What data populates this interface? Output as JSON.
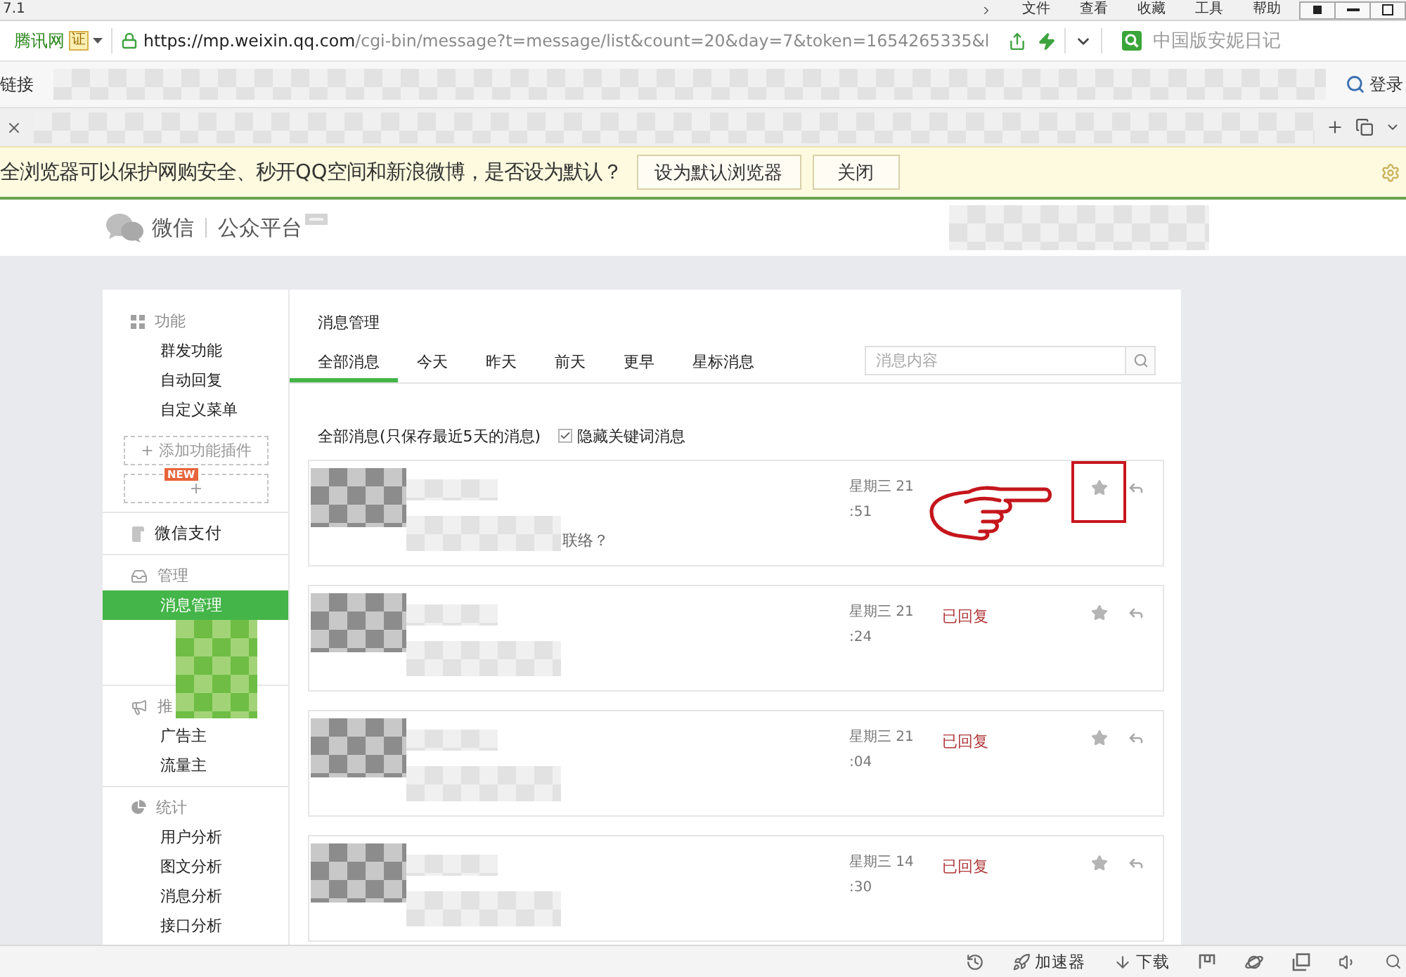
{
  "browser": {
    "title": "7.1",
    "menu": [
      "文件",
      "查看",
      "收藏",
      "工具",
      "帮助"
    ],
    "site_name": "腾讯网",
    "cert_badge": "证",
    "url": {
      "host": "https://mp.weixin.qq.com",
      "path": "/cgi-bin/message?t=message/list&count=20&day=7&token=1654265335&l"
    },
    "search": {
      "placeholder": "中国版安妮日记"
    },
    "bookmarks_label": "链接",
    "login": "登录"
  },
  "notification": {
    "message": "全浏览器可以保护网购安全、秒开QQ空间和新浪微博，是否设为默认？",
    "buttons": [
      "设为默认浏览器",
      "关闭"
    ]
  },
  "header": {
    "logo_text": "微信",
    "platform": "公众平台"
  },
  "sidebar": {
    "sections": [
      {
        "kind": "group",
        "title": "功能",
        "obscured": false,
        "items": [
          {
            "label": "群发功能",
            "selected": false
          },
          {
            "label": "自动回复",
            "selected": false
          },
          {
            "label": "自定义菜单",
            "selected": false
          }
        ],
        "plugins": [
          {
            "label": "+ 添加功能插件"
          },
          {
            "label": "+",
            "badge": "NEW"
          }
        ]
      },
      {
        "kind": "link",
        "title": "微信支付",
        "obscured": false
      },
      {
        "kind": "group",
        "title": "管理",
        "obscured": true,
        "items": [
          {
            "label": "消息管理",
            "selected": true
          }
        ]
      },
      {
        "kind": "group",
        "title": "推",
        "obscured": false,
        "items": [
          {
            "label": "广告主",
            "selected": false
          },
          {
            "label": "流量主",
            "selected": false
          }
        ]
      },
      {
        "kind": "group",
        "title": "统计",
        "obscured": false,
        "items": [
          {
            "label": "用户分析",
            "selected": false
          },
          {
            "label": "图文分析",
            "selected": false
          },
          {
            "label": "消息分析",
            "selected": false
          },
          {
            "label": "接口分析",
            "selected": false
          }
        ]
      }
    ]
  },
  "content": {
    "title": "消息管理",
    "tabs": [
      {
        "label": "全部消息",
        "selected": true
      },
      {
        "label": "今天",
        "selected": false
      },
      {
        "label": "昨天",
        "selected": false
      },
      {
        "label": "前天",
        "selected": false
      },
      {
        "label": "更早",
        "selected": false
      },
      {
        "label": "星标消息",
        "selected": false
      }
    ],
    "search": {
      "placeholder": "消息内容"
    },
    "filter": {
      "label": "全部消息(只保存最近5天的消息)",
      "hide_keywords": {
        "label": "隐藏关键词消息",
        "checked": true
      }
    },
    "messages": [
      {
        "preview": "联络？",
        "day": "星期三 21",
        "time": ":51",
        "starred": false,
        "highlighted": true
      },
      {
        "day": "星期三 21",
        "time": ":24",
        "status": "已回复",
        "starred": false,
        "highlighted": false
      },
      {
        "day": "星期三 21",
        "time": ":04",
        "status": "已回复",
        "starred": false,
        "highlighted": false
      },
      {
        "day": "星期三 14",
        "time": ":30",
        "status": "已回复",
        "starred": false,
        "highlighted": false
      }
    ]
  },
  "status_bar": {
    "accelerator": "加速器",
    "download": "下载"
  }
}
